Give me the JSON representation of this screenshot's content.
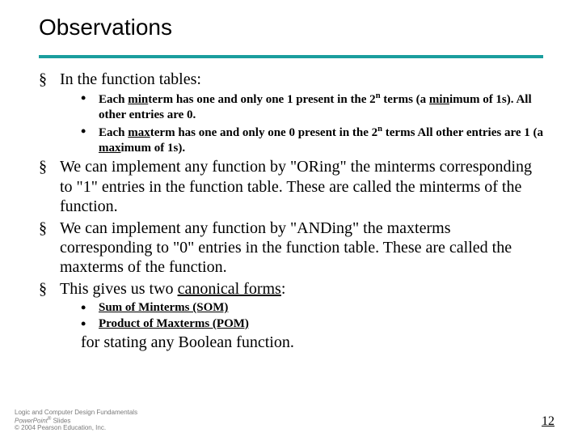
{
  "title": "Observations",
  "bullets": {
    "b1": "In the function tables:",
    "b1_sub1_a": "Each ",
    "b1_sub1_b": "min",
    "b1_sub1_c": "term has one and only one 1 present in the 2",
    "b1_sub1_sup": "n",
    "b1_sub1_d": "  terms (a ",
    "b1_sub1_e": "min",
    "b1_sub1_f": "imum of 1s).  All other entries are 0.",
    "b1_sub2_a": "Each ",
    "b1_sub2_b": "max",
    "b1_sub2_c": "term has one and only one 0 present in the 2",
    "b1_sub2_sup": "n",
    "b1_sub2_d": " terms All other entries are 1 (a ",
    "b1_sub2_e": "max",
    "b1_sub2_f": "imum of 1s).",
    "b2": "We can implement any function by \"ORing\" the minterms corresponding to \"1\" entries in the function table. These are called the minterms of the function.",
    "b3": "We can implement any function by \"ANDing\" the maxterms corresponding to \"0\" entries in the function table. These are called the maxterms of the function.",
    "b4_a": "This gives us two ",
    "b4_b": "canonical forms",
    "b4_c": ":",
    "b4_sub1": "Sum of Minterms (SOM)",
    "b4_sub2": "Product of Maxterms (POM)",
    "trailing": "for stating any Boolean function."
  },
  "footer": {
    "line1": "Logic and Computer Design Fundamentals",
    "line2a": "PowerPoint",
    "line2b": " Slides",
    "line3": "© 2004 Pearson Education, Inc."
  },
  "pagenum": "12"
}
